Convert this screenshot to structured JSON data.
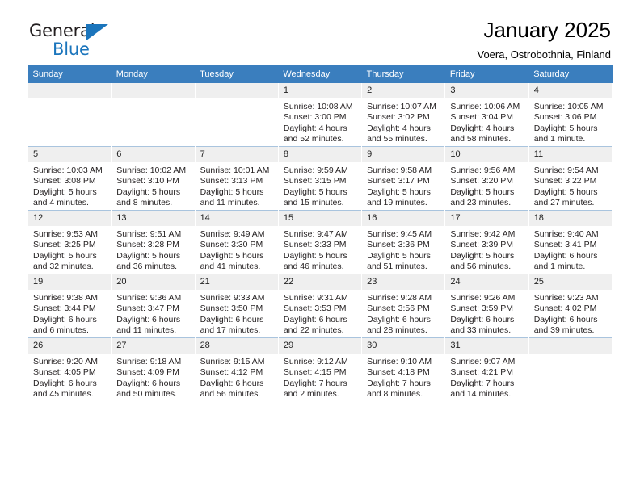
{
  "brand": {
    "name_top": "General",
    "name_bottom": "Blue",
    "accent_color": "#1b75bc"
  },
  "header": {
    "title": "January 2025",
    "subtitle": "Voera, Ostrobothnia, Finland",
    "header_bg": "#3a7ebe",
    "daynum_bg": "#efefef"
  },
  "weekdays": [
    "Sunday",
    "Monday",
    "Tuesday",
    "Wednesday",
    "Thursday",
    "Friday",
    "Saturday"
  ],
  "weeks": [
    [
      {
        "day": "",
        "empty": true,
        "sunrise": "",
        "sunset": "",
        "daylight1": "",
        "daylight2": ""
      },
      {
        "day": "",
        "empty": true,
        "sunrise": "",
        "sunset": "",
        "daylight1": "",
        "daylight2": ""
      },
      {
        "day": "",
        "empty": true,
        "sunrise": "",
        "sunset": "",
        "daylight1": "",
        "daylight2": ""
      },
      {
        "day": "1",
        "sunrise": "Sunrise: 10:08 AM",
        "sunset": "Sunset: 3:00 PM",
        "daylight1": "Daylight: 4 hours",
        "daylight2": "and 52 minutes."
      },
      {
        "day": "2",
        "sunrise": "Sunrise: 10:07 AM",
        "sunset": "Sunset: 3:02 PM",
        "daylight1": "Daylight: 4 hours",
        "daylight2": "and 55 minutes."
      },
      {
        "day": "3",
        "sunrise": "Sunrise: 10:06 AM",
        "sunset": "Sunset: 3:04 PM",
        "daylight1": "Daylight: 4 hours",
        "daylight2": "and 58 minutes."
      },
      {
        "day": "4",
        "sunrise": "Sunrise: 10:05 AM",
        "sunset": "Sunset: 3:06 PM",
        "daylight1": "Daylight: 5 hours",
        "daylight2": "and 1 minute."
      }
    ],
    [
      {
        "day": "5",
        "sunrise": "Sunrise: 10:03 AM",
        "sunset": "Sunset: 3:08 PM",
        "daylight1": "Daylight: 5 hours",
        "daylight2": "and 4 minutes."
      },
      {
        "day": "6",
        "sunrise": "Sunrise: 10:02 AM",
        "sunset": "Sunset: 3:10 PM",
        "daylight1": "Daylight: 5 hours",
        "daylight2": "and 8 minutes."
      },
      {
        "day": "7",
        "sunrise": "Sunrise: 10:01 AM",
        "sunset": "Sunset: 3:13 PM",
        "daylight1": "Daylight: 5 hours",
        "daylight2": "and 11 minutes."
      },
      {
        "day": "8",
        "sunrise": "Sunrise: 9:59 AM",
        "sunset": "Sunset: 3:15 PM",
        "daylight1": "Daylight: 5 hours",
        "daylight2": "and 15 minutes."
      },
      {
        "day": "9",
        "sunrise": "Sunrise: 9:58 AM",
        "sunset": "Sunset: 3:17 PM",
        "daylight1": "Daylight: 5 hours",
        "daylight2": "and 19 minutes."
      },
      {
        "day": "10",
        "sunrise": "Sunrise: 9:56 AM",
        "sunset": "Sunset: 3:20 PM",
        "daylight1": "Daylight: 5 hours",
        "daylight2": "and 23 minutes."
      },
      {
        "day": "11",
        "sunrise": "Sunrise: 9:54 AM",
        "sunset": "Sunset: 3:22 PM",
        "daylight1": "Daylight: 5 hours",
        "daylight2": "and 27 minutes."
      }
    ],
    [
      {
        "day": "12",
        "sunrise": "Sunrise: 9:53 AM",
        "sunset": "Sunset: 3:25 PM",
        "daylight1": "Daylight: 5 hours",
        "daylight2": "and 32 minutes."
      },
      {
        "day": "13",
        "sunrise": "Sunrise: 9:51 AM",
        "sunset": "Sunset: 3:28 PM",
        "daylight1": "Daylight: 5 hours",
        "daylight2": "and 36 minutes."
      },
      {
        "day": "14",
        "sunrise": "Sunrise: 9:49 AM",
        "sunset": "Sunset: 3:30 PM",
        "daylight1": "Daylight: 5 hours",
        "daylight2": "and 41 minutes."
      },
      {
        "day": "15",
        "sunrise": "Sunrise: 9:47 AM",
        "sunset": "Sunset: 3:33 PM",
        "daylight1": "Daylight: 5 hours",
        "daylight2": "and 46 minutes."
      },
      {
        "day": "16",
        "sunrise": "Sunrise: 9:45 AM",
        "sunset": "Sunset: 3:36 PM",
        "daylight1": "Daylight: 5 hours",
        "daylight2": "and 51 minutes."
      },
      {
        "day": "17",
        "sunrise": "Sunrise: 9:42 AM",
        "sunset": "Sunset: 3:39 PM",
        "daylight1": "Daylight: 5 hours",
        "daylight2": "and 56 minutes."
      },
      {
        "day": "18",
        "sunrise": "Sunrise: 9:40 AM",
        "sunset": "Sunset: 3:41 PM",
        "daylight1": "Daylight: 6 hours",
        "daylight2": "and 1 minute."
      }
    ],
    [
      {
        "day": "19",
        "sunrise": "Sunrise: 9:38 AM",
        "sunset": "Sunset: 3:44 PM",
        "daylight1": "Daylight: 6 hours",
        "daylight2": "and 6 minutes."
      },
      {
        "day": "20",
        "sunrise": "Sunrise: 9:36 AM",
        "sunset": "Sunset: 3:47 PM",
        "daylight1": "Daylight: 6 hours",
        "daylight2": "and 11 minutes."
      },
      {
        "day": "21",
        "sunrise": "Sunrise: 9:33 AM",
        "sunset": "Sunset: 3:50 PM",
        "daylight1": "Daylight: 6 hours",
        "daylight2": "and 17 minutes."
      },
      {
        "day": "22",
        "sunrise": "Sunrise: 9:31 AM",
        "sunset": "Sunset: 3:53 PM",
        "daylight1": "Daylight: 6 hours",
        "daylight2": "and 22 minutes."
      },
      {
        "day": "23",
        "sunrise": "Sunrise: 9:28 AM",
        "sunset": "Sunset: 3:56 PM",
        "daylight1": "Daylight: 6 hours",
        "daylight2": "and 28 minutes."
      },
      {
        "day": "24",
        "sunrise": "Sunrise: 9:26 AM",
        "sunset": "Sunset: 3:59 PM",
        "daylight1": "Daylight: 6 hours",
        "daylight2": "and 33 minutes."
      },
      {
        "day": "25",
        "sunrise": "Sunrise: 9:23 AM",
        "sunset": "Sunset: 4:02 PM",
        "daylight1": "Daylight: 6 hours",
        "daylight2": "and 39 minutes."
      }
    ],
    [
      {
        "day": "26",
        "sunrise": "Sunrise: 9:20 AM",
        "sunset": "Sunset: 4:05 PM",
        "daylight1": "Daylight: 6 hours",
        "daylight2": "and 45 minutes."
      },
      {
        "day": "27",
        "sunrise": "Sunrise: 9:18 AM",
        "sunset": "Sunset: 4:09 PM",
        "daylight1": "Daylight: 6 hours",
        "daylight2": "and 50 minutes."
      },
      {
        "day": "28",
        "sunrise": "Sunrise: 9:15 AM",
        "sunset": "Sunset: 4:12 PM",
        "daylight1": "Daylight: 6 hours",
        "daylight2": "and 56 minutes."
      },
      {
        "day": "29",
        "sunrise": "Sunrise: 9:12 AM",
        "sunset": "Sunset: 4:15 PM",
        "daylight1": "Daylight: 7 hours",
        "daylight2": "and 2 minutes."
      },
      {
        "day": "30",
        "sunrise": "Sunrise: 9:10 AM",
        "sunset": "Sunset: 4:18 PM",
        "daylight1": "Daylight: 7 hours",
        "daylight2": "and 8 minutes."
      },
      {
        "day": "31",
        "sunrise": "Sunrise: 9:07 AM",
        "sunset": "Sunset: 4:21 PM",
        "daylight1": "Daylight: 7 hours",
        "daylight2": "and 14 minutes."
      },
      {
        "day": "",
        "empty": true,
        "sunrise": "",
        "sunset": "",
        "daylight1": "",
        "daylight2": ""
      }
    ]
  ]
}
